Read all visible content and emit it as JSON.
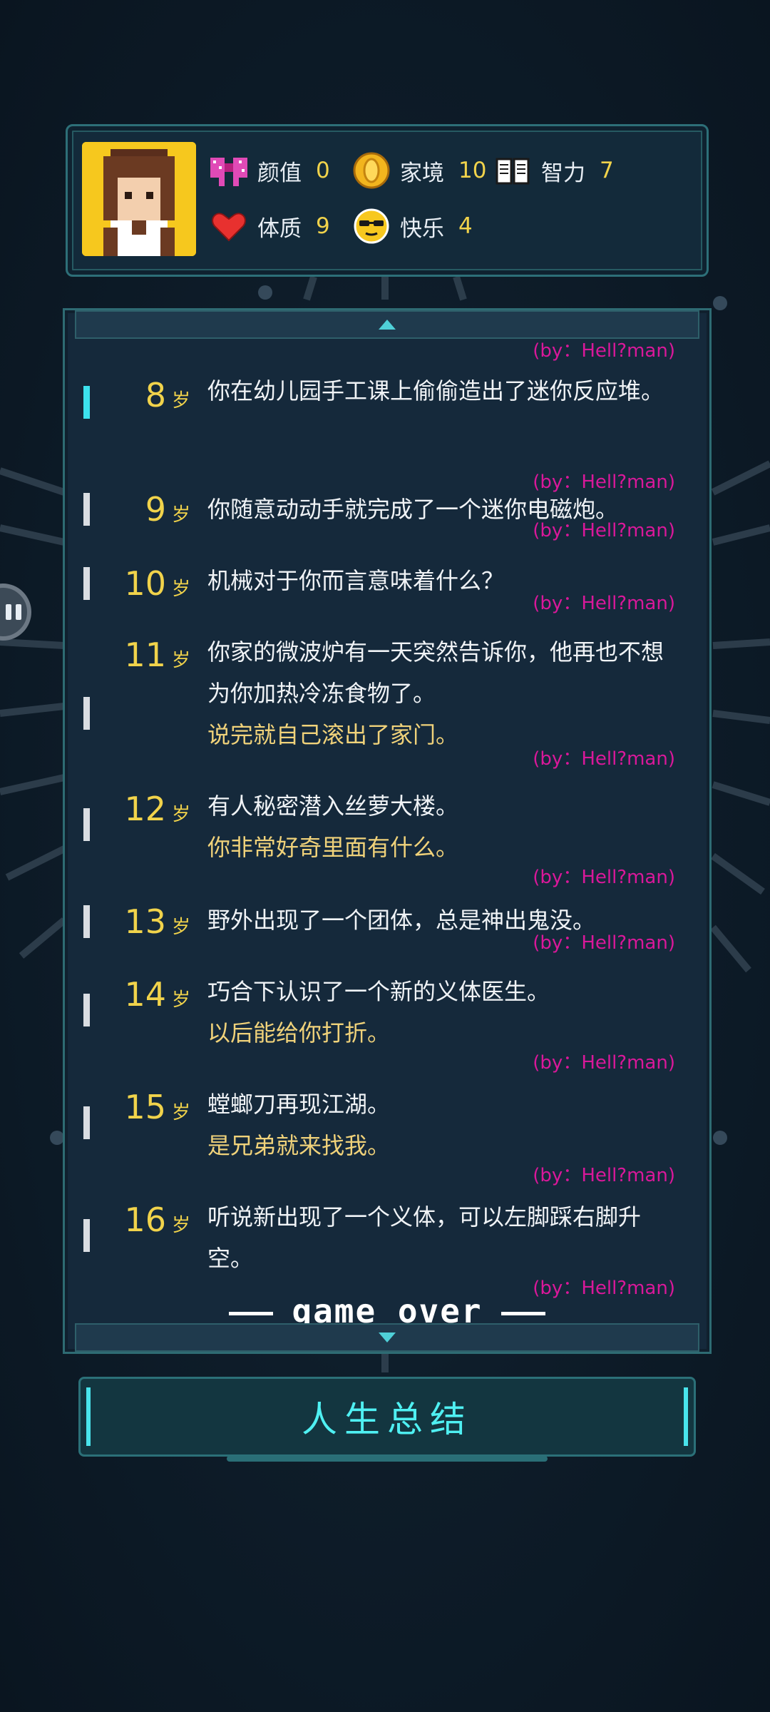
{
  "stats": [
    {
      "label": "颜值",
      "value": "0",
      "icon": "bow-icon",
      "color": "#e04ab6"
    },
    {
      "label": "家境",
      "value": "10",
      "icon": "coin-icon",
      "color": "#f2b51e"
    },
    {
      "label": "智力",
      "value": "7",
      "icon": "book-icon",
      "color": "#ffffff"
    },
    {
      "label": "体质",
      "value": "9",
      "icon": "heart-icon",
      "color": "#e8312f"
    },
    {
      "label": "快乐",
      "value": "4",
      "icon": "sunglasses-face-icon",
      "color": "#f7c81f"
    }
  ],
  "log": {
    "age_unit": "岁",
    "top_author": "(by：Hell?man)",
    "rows": [
      {
        "age": "8",
        "lines": [
          "你在幼儿园手工课上偷偷造出了迷你反应堆。"
        ],
        "sub": "",
        "author": "(by：Hell?man)"
      },
      {
        "age": "9",
        "lines": [
          "你随意动动手就完成了一个迷你电磁炮。"
        ],
        "sub": "",
        "author": "(by：Hell?man)"
      },
      {
        "age": "10",
        "lines": [
          "机械对于你而言意味着什么？"
        ],
        "sub": "",
        "author": "(by：Hell?man)"
      },
      {
        "age": "11",
        "lines": [
          "你家的微波炉有一天突然告诉你，他再也不想为你加热冷冻食物了。"
        ],
        "sub": "说完就自己滚出了家门。",
        "author": "(by：Hell?man)"
      },
      {
        "age": "12",
        "lines": [
          "有人秘密潜入丝萝大楼。"
        ],
        "sub": "你非常好奇里面有什么。",
        "author": "(by：Hell?man)"
      },
      {
        "age": "13",
        "lines": [
          "野外出现了一个团体，总是神出鬼没。"
        ],
        "sub": "",
        "author": "(by：Hell?man)"
      },
      {
        "age": "14",
        "lines": [
          "巧合下认识了一个新的义体医生。"
        ],
        "sub": "以后能给你打折。",
        "author": "(by：Hell?man)"
      },
      {
        "age": "15",
        "lines": [
          "螳螂刀再现江湖。"
        ],
        "sub": "是兄弟就来找我。",
        "author": "(by：Hell?man)"
      },
      {
        "age": "16",
        "lines": [
          "听说新出现了一个义体，可以左脚踩右脚升空。"
        ],
        "sub": "",
        "author": "(by：Hell?man)"
      }
    ],
    "game_over": "game over"
  },
  "summary_button": "人生总结"
}
